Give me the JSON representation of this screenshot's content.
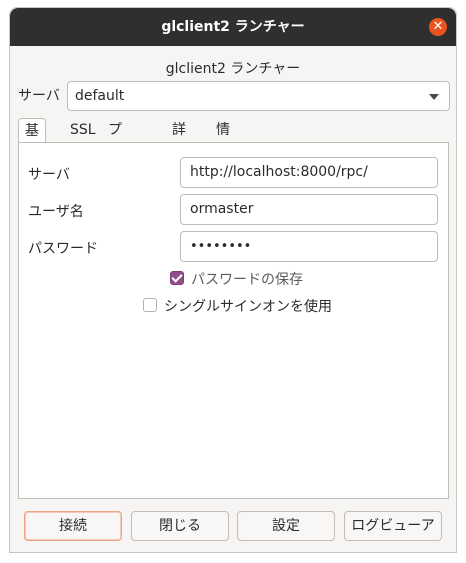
{
  "window": {
    "title": "glclient2 ランチャー"
  },
  "app_title": "glclient2 ランチャー",
  "server": {
    "label": "サーバ",
    "selected": "default"
  },
  "tabs": [
    {
      "label": "基本",
      "active": true
    },
    {
      "label": "SSL",
      "active": false
    },
    {
      "label": "プリンタ",
      "active": false
    },
    {
      "label": "詳細",
      "active": false
    },
    {
      "label": "情報",
      "active": false
    }
  ],
  "form": {
    "server_label": "サーバ",
    "server_value": "http://localhost:8000/rpc/",
    "user_label": "ユーザ名",
    "user_value": "ormaster",
    "password_label": "パスワード",
    "password_value": "••••••••"
  },
  "options": {
    "save_password": {
      "label": "パスワードの保存",
      "checked": true
    },
    "sso": {
      "label": "シングルサインオンを使用",
      "checked": false
    }
  },
  "buttons": {
    "connect": "接続",
    "close": "閉じる",
    "settings": "設定",
    "log_viewer": "ログビューア"
  },
  "colors": {
    "accent": "#e95420",
    "checkbox": "#924d8b",
    "titlebar": "#2f2f2f"
  }
}
